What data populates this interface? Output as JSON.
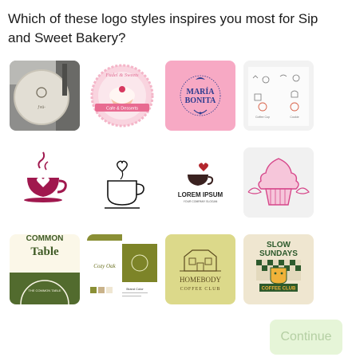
{
  "question": "Which of these logo styles inspires you most for Sip and Sweet Bakery?",
  "continue_label": "Continue",
  "tiles": {
    "t1": {
      "name": "round-sign-logo",
      "text": "ƒvü◦"
    },
    "t2": {
      "name": "cupcake-badge-logo",
      "top": "Fudel & Sweets",
      "band": "Cafe & Desserts"
    },
    "t3": {
      "name": "maria-bonita-logo",
      "line1": "MARÍA",
      "line2": "BONITA"
    },
    "t4": {
      "name": "line-icons-logo",
      "a": "Coffee Cup",
      "b": "Cookie"
    },
    "t5": {
      "name": "steaming-heart-cup-logo"
    },
    "t6": {
      "name": "line-coffee-cup-logo"
    },
    "t7": {
      "name": "lorem-ipsum-logo",
      "brand": "LOREM IPSUM",
      "tag": "YOUR COMPANY SLOGAN"
    },
    "t8": {
      "name": "pink-cupcake-logo"
    },
    "t9": {
      "name": "common-table-logo",
      "top": "COMMON",
      "main": "Table",
      "arc": "THE COMMON TABLE"
    },
    "t10": {
      "name": "cozy-oak-brand-sheet-logo",
      "brand": "Cozy Oak",
      "head": "Brand Color"
    },
    "t11": {
      "name": "homebody-coffee-club-logo",
      "line1": "HOMEBODY",
      "line2": "COFFEE CLUB"
    },
    "t12": {
      "name": "slow-sundays-logo",
      "line1": "SLOW",
      "line2": "SUNDAYS",
      "line3": "COFFEE CLUB"
    }
  },
  "colors": {
    "accent_green": "#e6f5d8",
    "disabled_text": "#b4cfa3",
    "pink": "#f7a9c4",
    "maroon": "#a0184e",
    "olive": "#5b6b2c",
    "mustard": "#d9d98a"
  }
}
